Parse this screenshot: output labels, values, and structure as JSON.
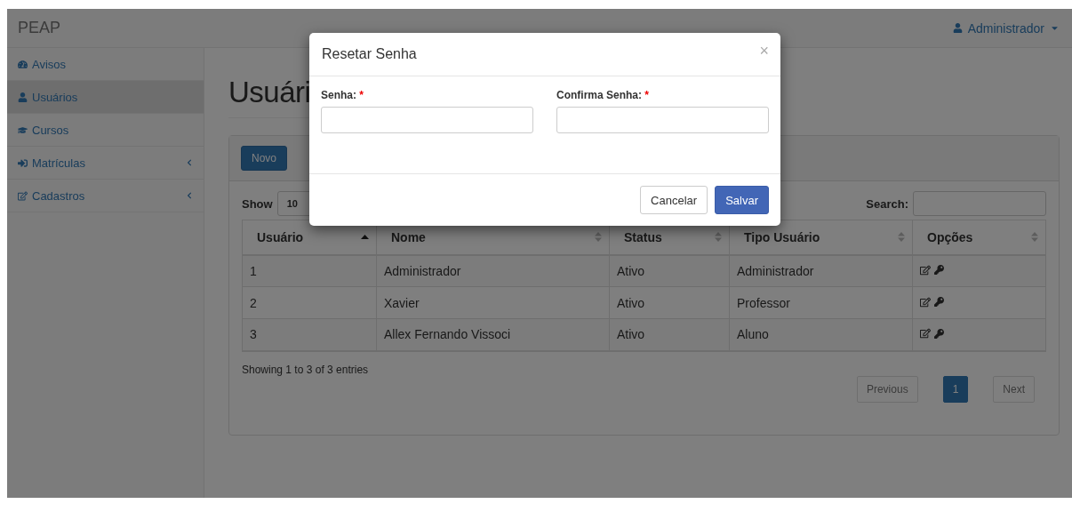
{
  "navbar": {
    "brand": "PEAP",
    "user": "Administrador"
  },
  "sidebar": {
    "items": [
      {
        "label": "Avisos",
        "selected": false,
        "kind": "plain"
      },
      {
        "label": "Usuários",
        "selected": true,
        "kind": "plain"
      },
      {
        "label": "Cursos",
        "selected": false,
        "kind": "plain"
      },
      {
        "label": "Matrículas",
        "selected": false,
        "kind": "submenu"
      },
      {
        "label": "Cadastros",
        "selected": false,
        "kind": "submenu"
      }
    ]
  },
  "page": {
    "title": "Usuári"
  },
  "panel": {
    "new_button": "Novo"
  },
  "table_controls": {
    "show_label": "Show",
    "page_length": "10",
    "search_label": "Search:"
  },
  "table": {
    "columns": [
      {
        "label": "Usuário",
        "sorted": true
      },
      {
        "label": "Nome",
        "sorted": false
      },
      {
        "label": "Status",
        "sorted": false
      },
      {
        "label": "Tipo Usuário",
        "sorted": false
      },
      {
        "label": "Opções",
        "sorted": false
      }
    ],
    "rows": [
      {
        "cells": [
          "1",
          "Administrador",
          "Ativo",
          "Administrador"
        ]
      },
      {
        "cells": [
          "2",
          "Xavier",
          "Ativo",
          "Professor"
        ]
      },
      {
        "cells": [
          "3",
          "Allex Fernando Vissoci",
          "Ativo",
          "Aluno"
        ]
      }
    ]
  },
  "info": "Showing 1 to 3 of 3 entries",
  "pagination": [
    {
      "label": "Previous",
      "disabled": true,
      "selected": false
    },
    {
      "label": "1",
      "disabled": false,
      "selected": true
    },
    {
      "label": "Next",
      "disabled": true,
      "selected": false
    }
  ],
  "modal": {
    "title": "Resetar Senha",
    "close": "×",
    "fields": [
      {
        "label": "Senha:",
        "required_mark": "*"
      },
      {
        "label": "Confirma Senha:",
        "required_mark": "*"
      }
    ],
    "buttons": [
      {
        "label": "Cancelar",
        "kind": "default"
      },
      {
        "label": "Salvar",
        "kind": "primary"
      }
    ]
  }
}
